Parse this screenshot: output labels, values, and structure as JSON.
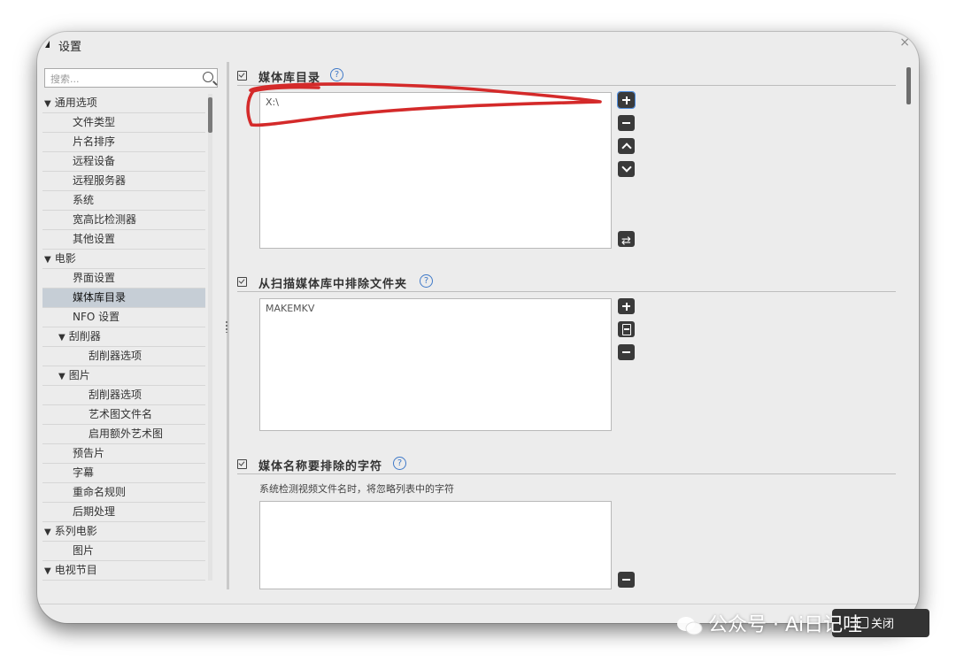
{
  "window": {
    "title": "设置"
  },
  "search": {
    "placeholder": "搜索..."
  },
  "tree": [
    {
      "label": "通用选项",
      "level": 0,
      "group": true
    },
    {
      "label": "文件类型",
      "level": 1
    },
    {
      "label": "片名排序",
      "level": 1
    },
    {
      "label": "远程设备",
      "level": 1
    },
    {
      "label": "远程服务器",
      "level": 1
    },
    {
      "label": "系统",
      "level": 1
    },
    {
      "label": "宽高比检测器",
      "level": 1
    },
    {
      "label": "其他设置",
      "level": 1
    },
    {
      "label": "电影",
      "level": 0,
      "group": true
    },
    {
      "label": "界面设置",
      "level": 1
    },
    {
      "label": "媒体库目录",
      "level": 1,
      "selected": true
    },
    {
      "label": "NFO 设置",
      "level": 1
    },
    {
      "label": "刮削器",
      "level": 1,
      "group": true
    },
    {
      "label": "刮削器选项",
      "level": 2
    },
    {
      "label": "图片",
      "level": 1,
      "group": true
    },
    {
      "label": "刮削器选项",
      "level": 2
    },
    {
      "label": "艺术图文件名",
      "level": 2
    },
    {
      "label": "启用额外艺术图",
      "level": 2
    },
    {
      "label": "预告片",
      "level": 1
    },
    {
      "label": "字幕",
      "level": 1
    },
    {
      "label": "重命名规则",
      "level": 1
    },
    {
      "label": "后期处理",
      "level": 1
    },
    {
      "label": "系列电影",
      "level": 0,
      "group": true
    },
    {
      "label": "图片",
      "level": 1
    },
    {
      "label": "电视节目",
      "level": 0,
      "group": true
    }
  ],
  "sections": {
    "library": {
      "title": "媒体库目录",
      "help": "?",
      "entries": [
        "X:\\"
      ]
    },
    "exclude": {
      "title": "从扫描媒体库中排除文件夹",
      "help": "?",
      "entries": [
        "MAKEMKV"
      ]
    },
    "chars": {
      "title": "媒体名称要排除的字符",
      "help": "?",
      "description": "系统检测视频文件名时，将忽略列表中的字符",
      "entries": []
    }
  },
  "footer": {
    "button_label": "关闭"
  },
  "watermark": {
    "text": "公众号 · Ai日记哇"
  },
  "colors": {
    "annotation": "#d42a2a",
    "selected_row": "#c6ced6",
    "help_icon": "#3f79c8"
  }
}
